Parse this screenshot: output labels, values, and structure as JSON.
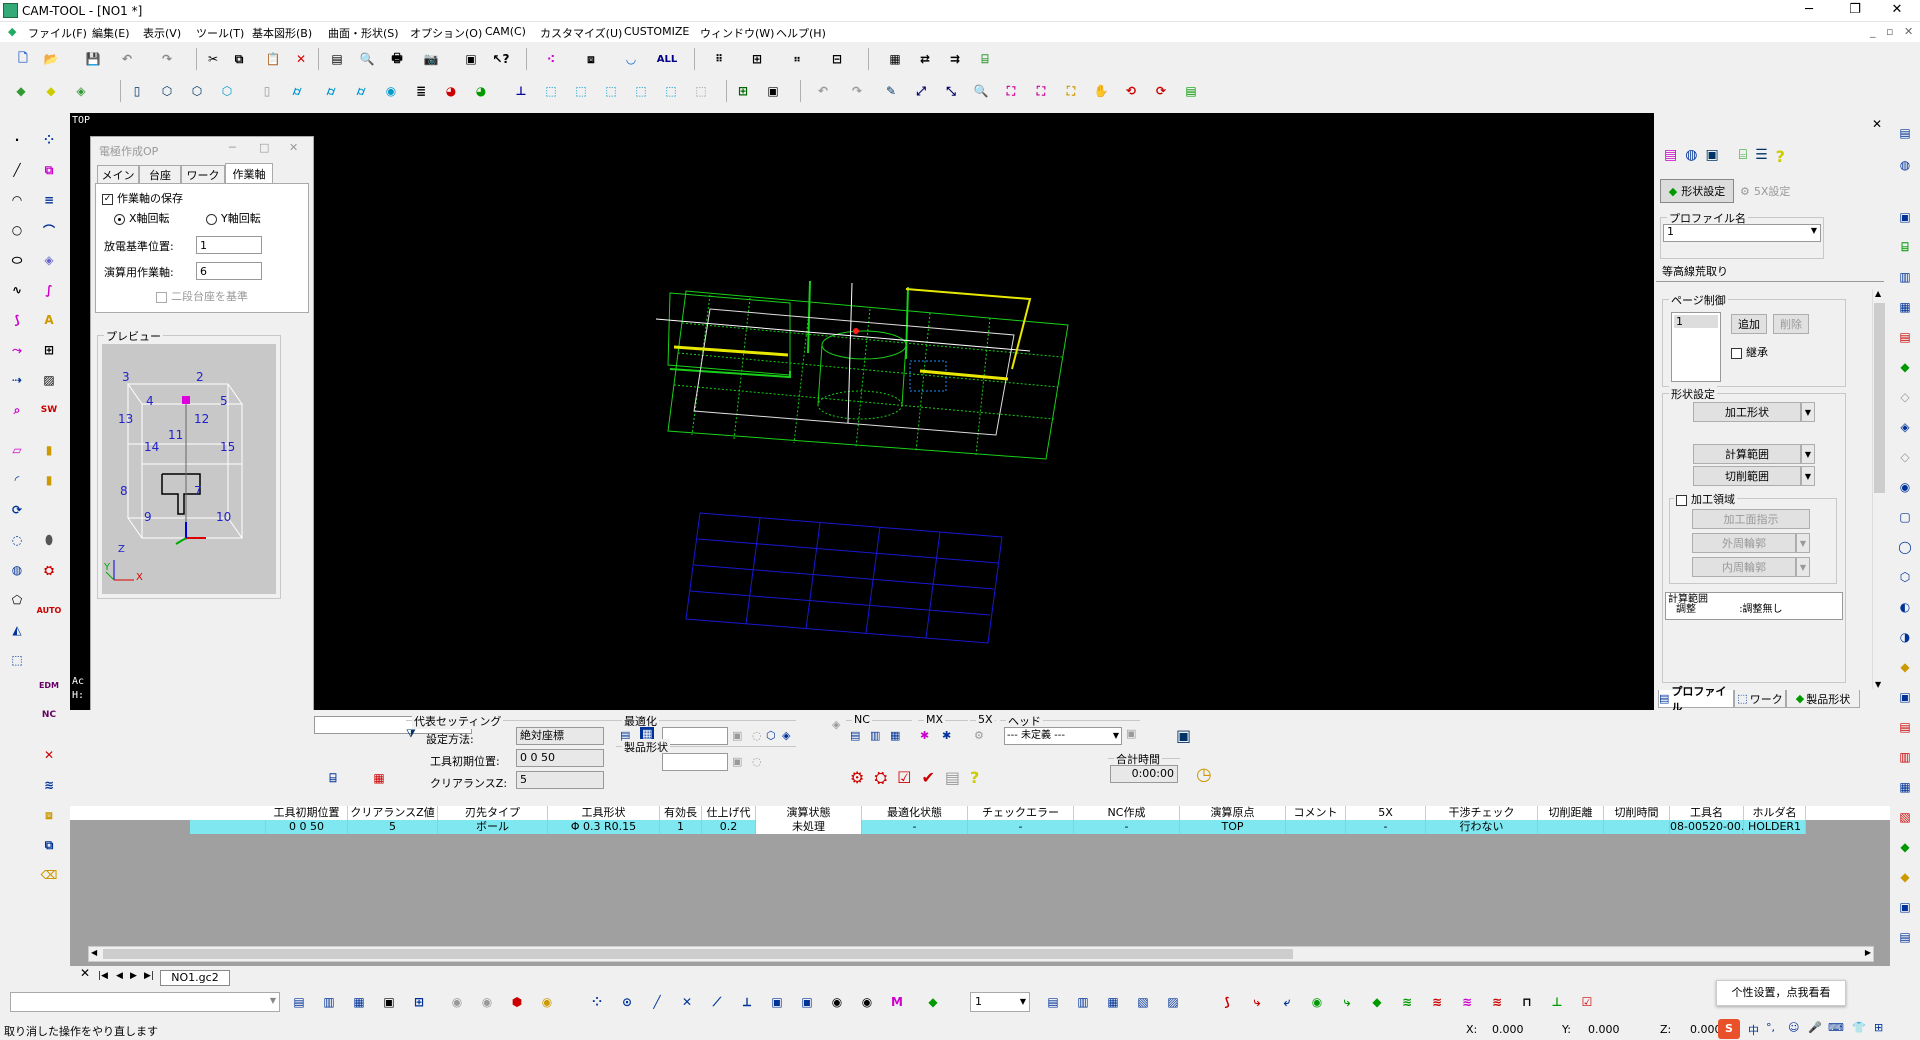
{
  "window": {
    "title": "CAM-TOOL - [NO1 *]",
    "min": "─",
    "max": "❐",
    "close": "✕"
  },
  "menu": [
    "ファイル(F)",
    "編集(E)",
    "表示(V)",
    "ツール(T)",
    "基本図形(B)",
    "曲面・形状(S)",
    "オプション(O)",
    "CAM(C)",
    "カスタマイズ(U)",
    "CUSTOMIZE",
    "ウィンドウ(W)",
    "ヘルプ(H)"
  ],
  "viewport": {
    "label": "TOP",
    "side_text1": "Ac",
    "side_text2": "H:"
  },
  "dialog": {
    "title": "電極作成OP",
    "min": "─",
    "max": "□",
    "close": "✕",
    "tabs": [
      "メイン",
      "台座",
      "ワーク",
      "作業軸"
    ],
    "save_axis_label": "作業軸の保存",
    "x_rot": "X軸回転",
    "y_rot": "Y軸回転",
    "discharge_label": "放電基準位置:",
    "discharge_value": "1",
    "calc_axis_label": "演算用作業軸:",
    "calc_axis_value": "6",
    "two_stage_label": "二段台座を基準",
    "preview_label": "プレビュー",
    "preview_nums": [
      "3",
      "2",
      "4",
      "5",
      "13",
      "11",
      "12",
      "14",
      "15",
      "8",
      "7",
      "9",
      "10"
    ],
    "axis_z": "Z",
    "axis_y": "Y",
    "axis_x": "X"
  },
  "rightpanel": {
    "shape_setting_btn": "形状設定",
    "five_x_btn": "5X設定",
    "profile_name_label": "プロファイル名",
    "profile_value": "1",
    "profile_desc": "等高線荒取り",
    "page_ctrl_label": "ページ制御",
    "page_item": "1",
    "add_btn": "追加",
    "del_btn": "削除",
    "inherit": "継承",
    "shape_group": "形状設定",
    "machining_shape": "加工形状",
    "calc_range": "計算範囲",
    "cut_range": "切削範囲",
    "machining_area": "加工領域",
    "machining_surface": "加工面指示",
    "outer_contour": "外周輪郭",
    "inner_contour": "内周輪郭",
    "calc_range2": "計算範囲",
    "adjust": "調整",
    "no_adjust": ":調整無し",
    "tabs": [
      "プロファイル",
      "ワーク",
      "製品形状"
    ]
  },
  "bottom": {
    "rep_setting": "代表セッティング",
    "set_method_label": "設定方法:",
    "set_method_value": "絶対座標",
    "tool_init_label": "工具初期位置:",
    "tool_init_value": "0 0 50",
    "clearance_label": "クリアランスZ:",
    "clearance_value": "5",
    "optimize": "最適化",
    "product_shape": "製品形状",
    "nc": "NC",
    "mx": "MX",
    "fivex": "5X",
    "head": "ヘッド",
    "head_value": "--- 未定義 ---",
    "total_time": "合計時間",
    "total_time_value": "0:00:00"
  },
  "table": {
    "headers": [
      "工具初期位置",
      "クリアランスZ値",
      "刃先タイプ",
      "工具形状",
      "有効長",
      "仕上げ代",
      "演算状態",
      "最適化状態",
      "チェックエラー",
      "NC作成",
      "演算原点",
      "コメント",
      "5X",
      "干渉チェック",
      "切削距離",
      "切削時間",
      "工具名",
      "ホルダ名"
    ],
    "row": [
      "0 0 50",
      "5",
      "ボール",
      "Φ 0.3 R0.15",
      "1",
      "0.2",
      "未処理",
      "-",
      "-",
      "-",
      "TOP",
      "",
      "-",
      "行わない",
      "",
      "",
      "08-00520-00...",
      "HOLDER1"
    ],
    "sheet_tab": "NO1.gc2"
  },
  "bottom_toolbar": {
    "layer_value": "1"
  },
  "status": {
    "message": "取り消した操作をやり直します",
    "x_label": "X:",
    "x_value": "0.000",
    "y_label": "Y:",
    "y_value": "0.000",
    "z_label": "Z:",
    "z_value": "0.000",
    "ime_tooltip": "个性设置，点我看看",
    "ime_lang": "中"
  },
  "colors": {
    "viewport_bg": "#000000",
    "green": "#19d019",
    "yellow": "#e8e800",
    "blue": "#1818d0",
    "row_cyan": "#7fe7f0"
  }
}
